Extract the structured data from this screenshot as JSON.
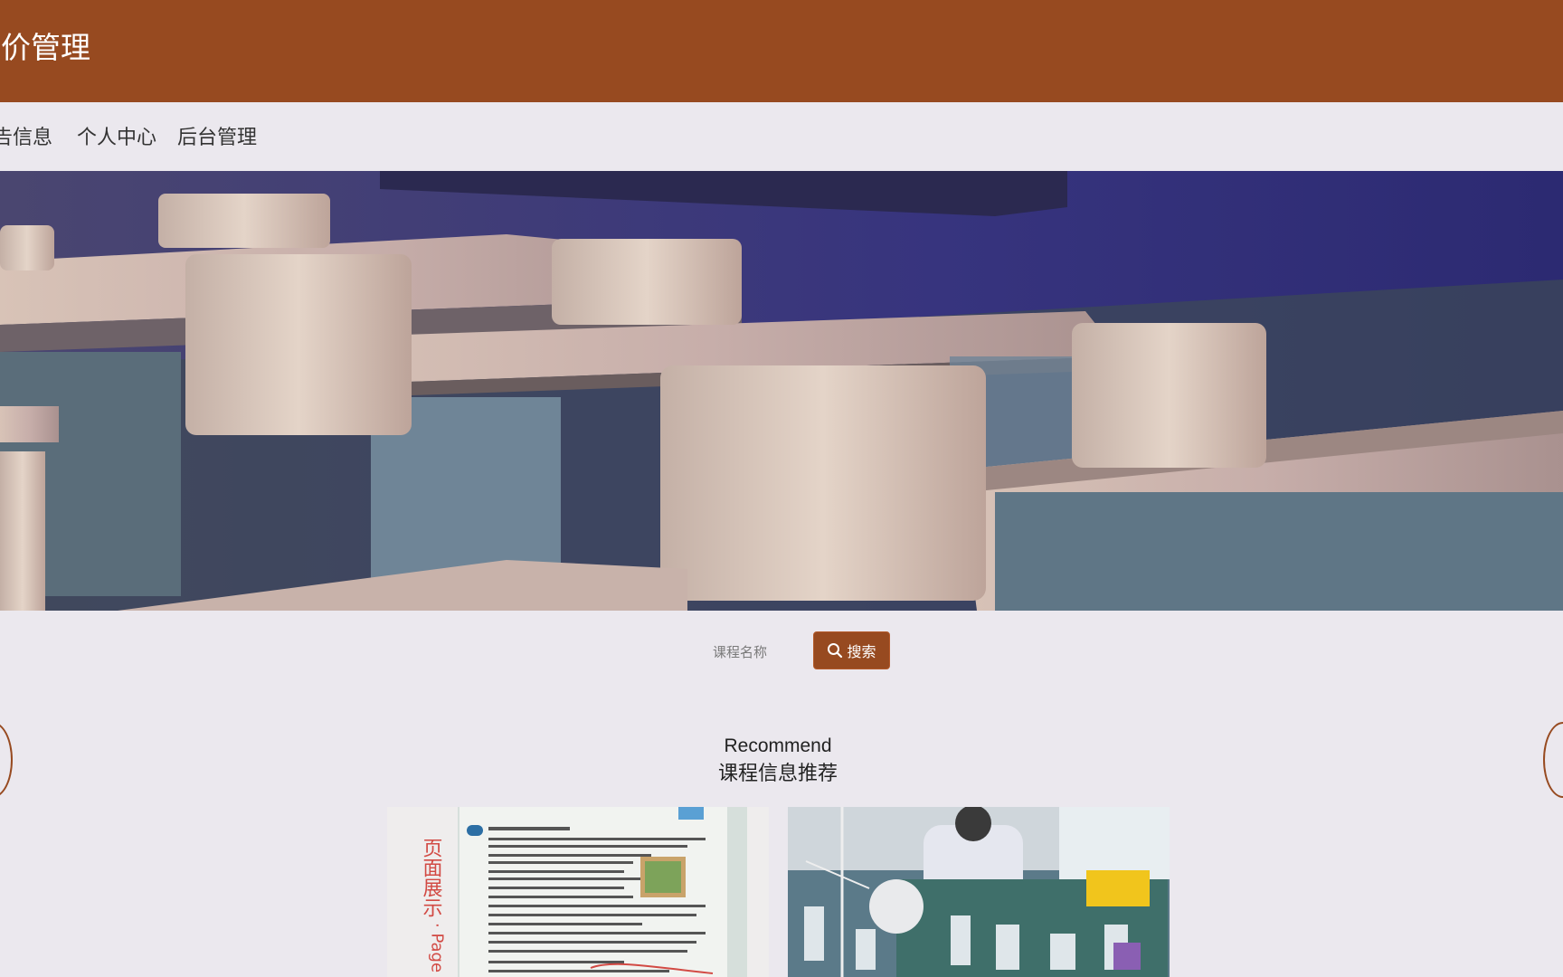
{
  "app": {
    "title": "评价管理"
  },
  "nav": {
    "items": [
      "告信息",
      "个人中心",
      "后台管理"
    ]
  },
  "carousel": {
    "active_index": 0,
    "count": 3,
    "active_color": "#974a20"
  },
  "search": {
    "placeholder": "课程名称",
    "button_label": "搜索"
  },
  "recommend": {
    "title_en": "Recommend",
    "title_cn": "课程信息推荐"
  },
  "cards": [
    {
      "image": "textbook-page-photo",
      "side_text": "页面展示 · Page"
    },
    {
      "image": "chemistry-lab-photo"
    }
  ],
  "colors": {
    "brand": "#974a20",
    "background": "#ebe8ee"
  }
}
